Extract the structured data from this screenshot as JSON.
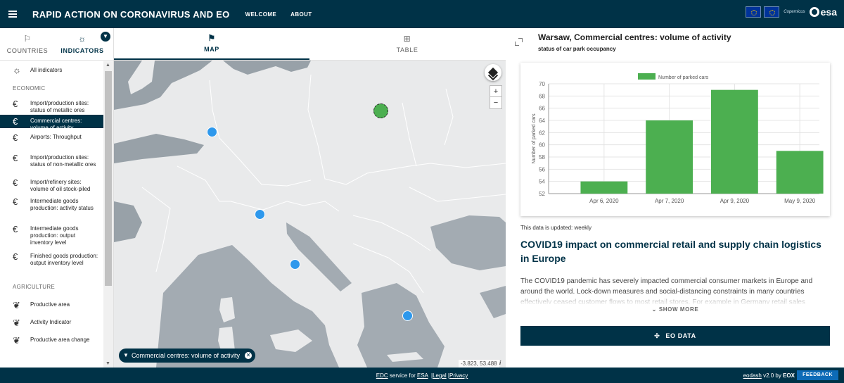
{
  "header": {
    "title": "RAPID ACTION ON CORONAVIRUS AND EO",
    "nav": [
      "WELCOME",
      "ABOUT"
    ],
    "copernicus": "Copernicus",
    "esa": "esa"
  },
  "left_tabs": [
    {
      "label": "COUNTRIES",
      "icon": "flag-icon"
    },
    {
      "label": "INDICATORS",
      "icon": "lightbulb-icon"
    }
  ],
  "indicators": {
    "all": "All indicators",
    "sections": [
      {
        "name": "ECONOMIC",
        "items": [
          {
            "label": "Import/production sites: status of metallic ores",
            "icon": "euro-icon"
          },
          {
            "label": "Commercial centres: volume of activity",
            "icon": "euro-icon",
            "active": true
          },
          {
            "label": "Airports: Throughput",
            "icon": "euro-icon"
          },
          {
            "label": "Import/production sites: status of non-metallic ores",
            "icon": "euro-icon"
          },
          {
            "label": "Import/refinery sites: volume of oil stock-piled",
            "icon": "euro-icon"
          },
          {
            "label": "Intermediate goods production: activity status",
            "icon": "euro-icon"
          },
          {
            "label": "Intermediate goods production: output inventory level",
            "icon": "euro-icon"
          },
          {
            "label": "Finished goods production: output inventory level",
            "icon": "euro-icon"
          }
        ]
      },
      {
        "name": "AGRICULTURE",
        "items": [
          {
            "label": "Productive area",
            "icon": "leaf-icon"
          },
          {
            "label": "Activity Indicator",
            "icon": "leaf-icon"
          },
          {
            "label": "Productive area change",
            "icon": "leaf-icon"
          }
        ]
      }
    ]
  },
  "map_tabs": [
    {
      "label": "MAP",
      "icon": "map-search-icon"
    },
    {
      "label": "TABLE",
      "icon": "table-search-icon"
    }
  ],
  "map": {
    "filter_chip": "Commercial centres: volume of activity",
    "coordinates": "-3.823, 53.488",
    "zoom_in": "+",
    "zoom_out": "−",
    "info": "i"
  },
  "panel": {
    "title": "Warsaw, Commercial centres: volume of activity",
    "subtitle": "status of car park occupancy",
    "update": "This data is updated: weekly",
    "article_title": "COVID19 impact on commercial retail and supply chain logistics in Europe",
    "article_body": "The COVID19 pandemic has severely impacted commercial consumer markets in Europe and around the world. Lock-down measures and social-distancing constraints in many countries effectively ceased customer flows to most retail stores. For example in Germany retail sales",
    "show_more": "SHOW MORE",
    "eo_button": "EO DATA"
  },
  "chart_data": {
    "type": "bar",
    "categories": [
      "Apr 6, 2020",
      "Apr 7, 2020",
      "Apr 9, 2020",
      "May 9, 2020"
    ],
    "series": [
      {
        "name": "Number of parked cars",
        "values": [
          54,
          64,
          69,
          59
        ]
      }
    ],
    "ylabel": "Number of parked cars",
    "xlabel": "",
    "ylim": [
      52,
      70
    ],
    "yticks": [
      52,
      54,
      56,
      58,
      60,
      62,
      64,
      66,
      68,
      70
    ],
    "legend": "top",
    "grid": true,
    "bar_color": "#4caf50"
  },
  "footer": {
    "edc": "EDC",
    "service_for": " service for ",
    "esa": "ESA",
    "legal": "Legal",
    "privacy": "Privacy",
    "eodash": "eodash",
    "version": " v2.0 by ",
    "eox": "EOX",
    "feedback": "FEEDBACK"
  },
  "colors": {
    "primary": "#003247",
    "marker": "#2e98ec",
    "selected_marker": "#4caf50",
    "feedback": "#0d6bb7"
  }
}
